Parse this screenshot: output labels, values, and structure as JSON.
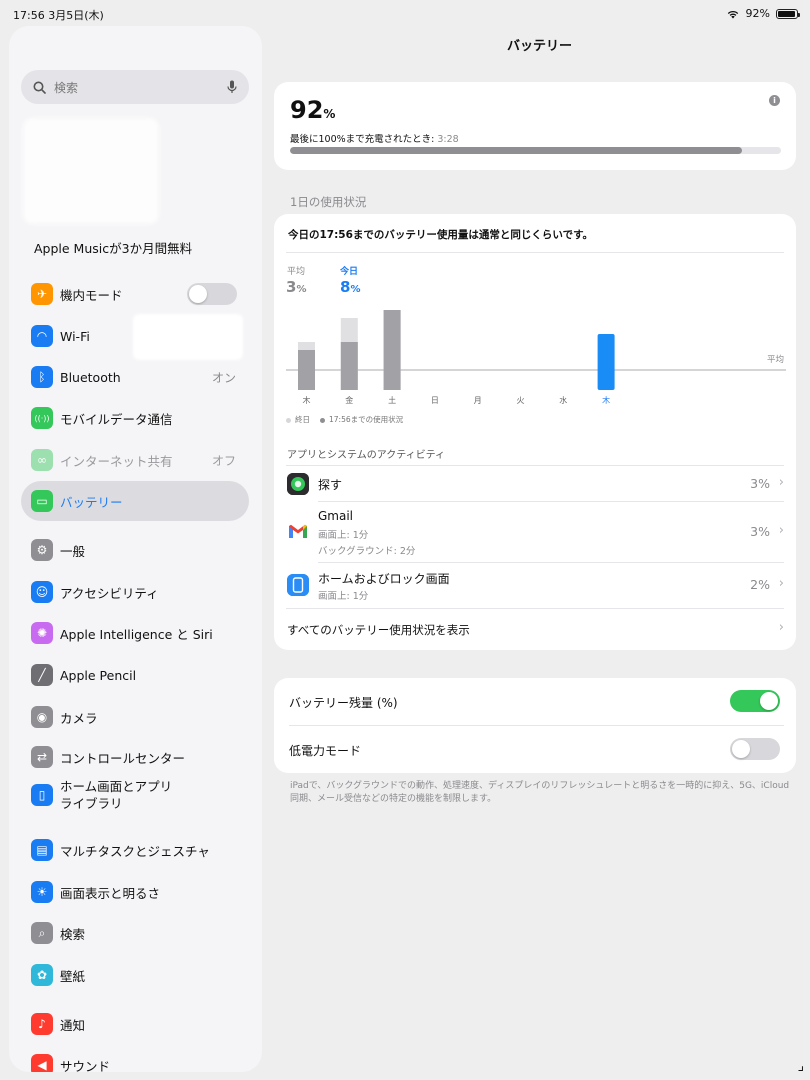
{
  "status_bar": {
    "time_date": "17:56  3月5日(木)",
    "battery_pct": "92%",
    "battery_level": 0.92
  },
  "sidebar": {
    "search_placeholder": "検索",
    "promo": "Apple Musicが3か月間無料",
    "items": [
      {
        "label": "機内モード",
        "value": "",
        "icon": "airplane-icon",
        "color": "#ff9500",
        "toggle": false
      },
      {
        "label": "Wi-Fi",
        "value": "",
        "icon": "wifi-icon",
        "color": "#1a7cf2"
      },
      {
        "label": "Bluetooth",
        "value": "オン",
        "icon": "bluetooth-icon",
        "color": "#1a7cf2"
      },
      {
        "label": "モバイルデータ通信",
        "value": "",
        "icon": "antenna-icon",
        "color": "#34c759"
      },
      {
        "label": "インターネット共有",
        "value": "オフ",
        "icon": "link-icon",
        "color": "#34c759"
      },
      {
        "label": "バッテリー",
        "value": "",
        "icon": "battery-icon",
        "color": "#34c759"
      },
      {
        "label": "一般",
        "value": "",
        "icon": "gear-icon",
        "color": "#8e8e93"
      },
      {
        "label": "アクセシビリティ",
        "value": "",
        "icon": "accessibility-icon",
        "color": "#1a7cf2"
      },
      {
        "label": "Apple Intelligence と Siri",
        "value": "",
        "icon": "siri-icon",
        "color": "#c96bf0"
      },
      {
        "label": "Apple Pencil",
        "value": "",
        "icon": "pencil-icon",
        "color": "#6e6e73"
      },
      {
        "label": "カメラ",
        "value": "",
        "icon": "camera-icon",
        "color": "#8e8e93"
      },
      {
        "label": "コントロールセンター",
        "value": "",
        "icon": "toggles-icon",
        "color": "#8e8e93"
      },
      {
        "label": "ホーム画面とアプリ",
        "label2": "ライブラリ",
        "value": "",
        "icon": "home-screen-icon",
        "color": "#1a7cf2"
      },
      {
        "label": "マルチタスクとジェスチャ",
        "value": "",
        "icon": "multitask-icon",
        "color": "#1a7cf2"
      },
      {
        "label": "画面表示と明るさ",
        "value": "",
        "icon": "sun-icon",
        "color": "#1a7cf2"
      },
      {
        "label": "検索",
        "value": "",
        "icon": "search-icon",
        "color": "#8e8e93"
      },
      {
        "label": "壁紙",
        "value": "",
        "icon": "flower-icon",
        "color": "#2fb8d9"
      },
      {
        "label": "通知",
        "value": "",
        "icon": "bell-icon",
        "color": "#ff3b30"
      },
      {
        "label": "サウンド",
        "value": "",
        "icon": "speaker-icon",
        "color": "#ff3b30"
      }
    ]
  },
  "main": {
    "title": "バッテリー",
    "level": {
      "value": "92",
      "unit": "%",
      "last_charge_label": "最後に100%まで充電されたとき: ",
      "last_charge_time": "3:28",
      "fraction": 0.92
    },
    "usage_section": "1日の使用状況",
    "usage_message": "今日の17:56までのバッテリー使用量は通常と同じくらいです。",
    "average": {
      "label": "平均",
      "value": "3",
      "unit": "%"
    },
    "today": {
      "label": "今日",
      "value": "8",
      "unit": "%"
    },
    "legend": {
      "all_day": "終日",
      "until_now": "17:56までの使用状況"
    },
    "activity_title": "アプリとシステムのアクティビティ",
    "apps": [
      {
        "name": "探す",
        "sub": [],
        "pct": "3%",
        "icon": "findmy-icon"
      },
      {
        "name": "Gmail",
        "sub": [
          "画面上: 1分",
          "バックグラウンド: 2分"
        ],
        "pct": "3%",
        "icon": "gmail-icon"
      },
      {
        "name": "ホームおよびロック画面",
        "sub": [
          "画面上: 1分"
        ],
        "pct": "2%",
        "icon": "home-lock-icon"
      }
    ],
    "show_all": "すべてのバッテリー使用状況を表示",
    "settings": [
      {
        "label": "バッテリー残量 (%)",
        "on": true
      },
      {
        "label": "低電力モード",
        "on": false
      }
    ],
    "footnote": "iPadで、バックグラウンドでの動作、処理速度、ディスプレイのリフレッシュレートと明るさを一時的に抑え、5G、iCloud同期、メール受信などの特定の機能を制限します。"
  },
  "chart_data": {
    "type": "bar",
    "categories": [
      "木",
      "金",
      "土",
      "日",
      "月",
      "火",
      "水",
      "木"
    ],
    "series": [
      {
        "name": "終日",
        "values": [
          6,
          9,
          10,
          0,
          0,
          0,
          0,
          0
        ]
      },
      {
        "name": "17:56までの使用状況",
        "values": [
          5,
          6,
          10,
          0,
          0,
          0,
          0,
          7
        ]
      }
    ],
    "reference_line": {
      "label": "平均",
      "value": 3
    },
    "highlight_index": 7,
    "colors": {
      "all_day": "#e0e0e3",
      "until_now": "#a1a1a6",
      "today": "#1a8cf5"
    }
  }
}
